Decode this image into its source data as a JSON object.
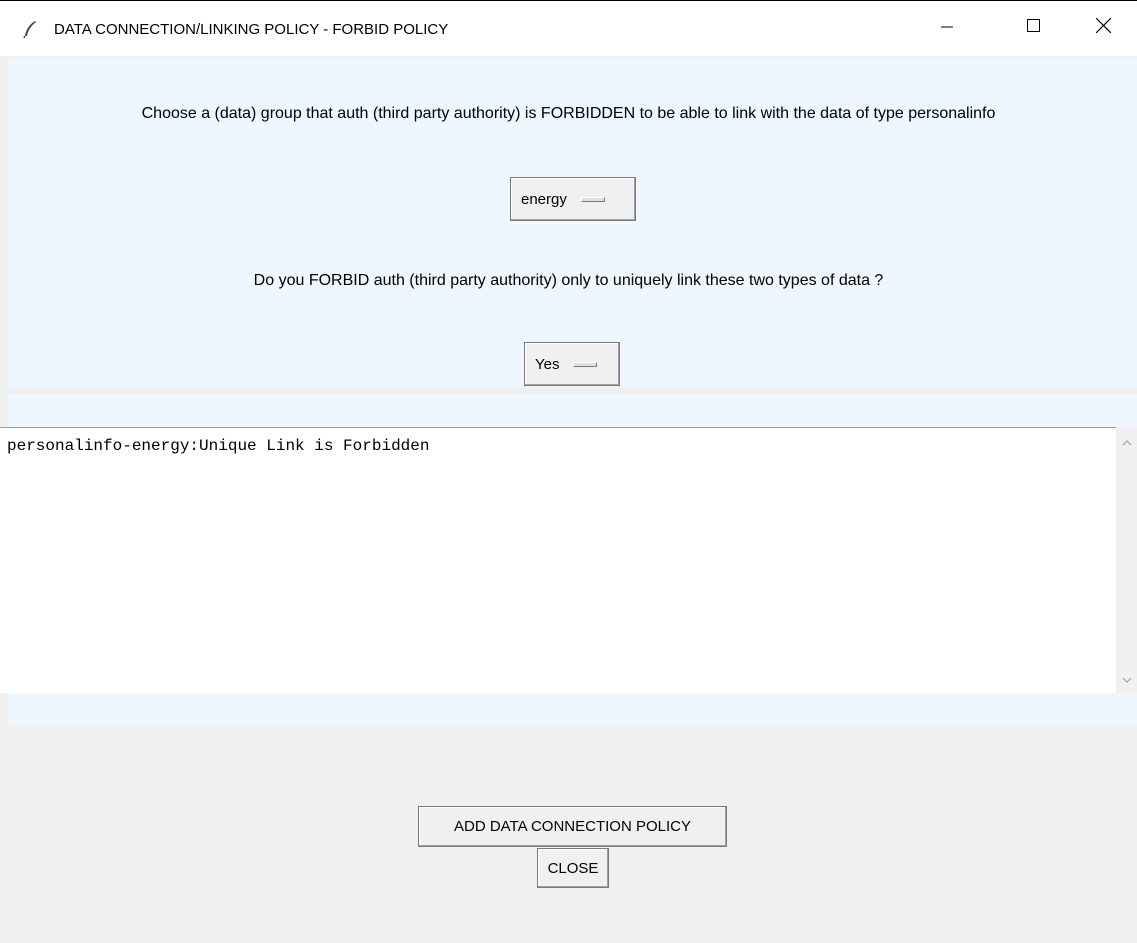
{
  "window": {
    "title": "DATA CONNECTION/LINKING POLICY - FORBID POLICY",
    "icons": {
      "app": "feather-icon",
      "minimize": "minimize-icon",
      "maximize": "maximize-icon",
      "close": "close-icon"
    }
  },
  "form": {
    "prompt_group": "Choose a (data) group that auth (third party authority) is FORBIDDEN to be able to link with the data of type personalinfo",
    "group_selected": "energy",
    "prompt_unique": "Do you FORBID auth (third party authority) only to uniquely link these two types of data ?",
    "unique_selected": "Yes"
  },
  "output": {
    "text": "personalinfo-energy:Unique Link is Forbidden"
  },
  "buttons": {
    "add": "ADD DATA CONNECTION POLICY",
    "close": "CLOSE"
  },
  "colors": {
    "panel_bg": "#eef6fe",
    "window_bg": "#f0f0f0"
  }
}
